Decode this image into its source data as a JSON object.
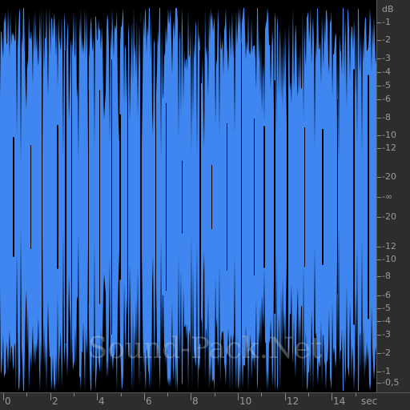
{
  "colors": {
    "waveform": "#3f86f0",
    "background": "#000000",
    "ruler_bg": "#2d2d2d",
    "ruler_text": "#9a9a9a"
  },
  "db_scale": {
    "unit_label": "dB",
    "ticks_top": [
      "-1",
      "-2",
      "-3",
      "-4",
      "-5",
      "-6",
      "-8",
      "-10",
      "-12",
      "-20"
    ],
    "center_label": "-∞",
    "ticks_bottom": [
      "-20",
      "-12",
      "-10",
      "-8",
      "-6",
      "-5",
      "-4",
      "-3",
      "-2",
      "-1",
      "-0,5"
    ]
  },
  "time_scale": {
    "labels": [
      "0",
      "2",
      "4",
      "6",
      "8",
      "10",
      "12",
      "14"
    ],
    "unit_label": "sec"
  },
  "watermark": "Sound-Pack.Net"
}
